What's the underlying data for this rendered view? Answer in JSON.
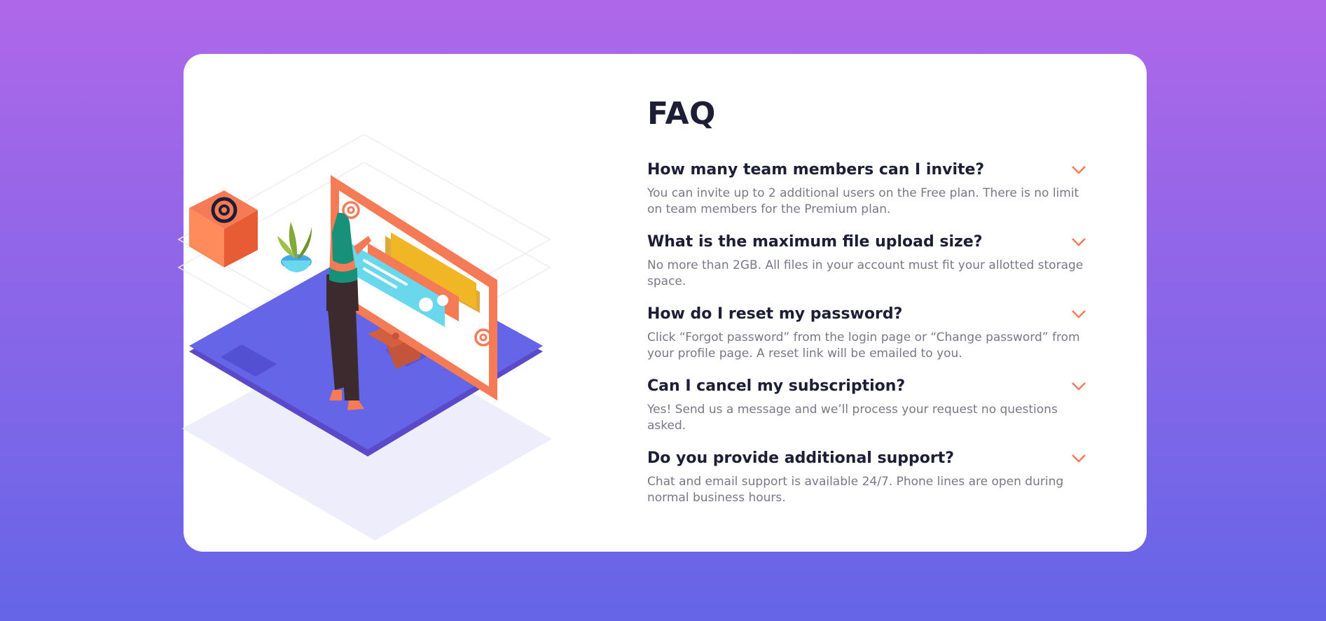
{
  "page": {
    "accent_color": "#f47b56",
    "heading_color": "#1d1e35",
    "text_color": "#787887",
    "background_gradient": [
      "#af67e9",
      "#6565e7"
    ]
  },
  "faq": {
    "title": "FAQ",
    "chevron_icon": "chevron-down-icon",
    "items": [
      {
        "question": "How many team members can I invite?",
        "answer": "You can invite up to 2 additional users on the Free plan. There is no limit on team members for the Premium plan."
      },
      {
        "question": "What is the maximum file upload size?",
        "answer": "No more than 2GB. All files in your account must fit your allotted storage space."
      },
      {
        "question": "How do I reset my password?",
        "answer": "Click “Forgot password” from the login page or “Change password” from your profile page. A reset link will be emailed to you."
      },
      {
        "question": "Can I cancel my subscription?",
        "answer": "Yes! Send us a message and we’ll process your request no questions asked."
      },
      {
        "question": "Do you provide additional support?",
        "answer": "Chat and email support is available 24/7. Phone lines are open during normal business hours."
      }
    ]
  }
}
